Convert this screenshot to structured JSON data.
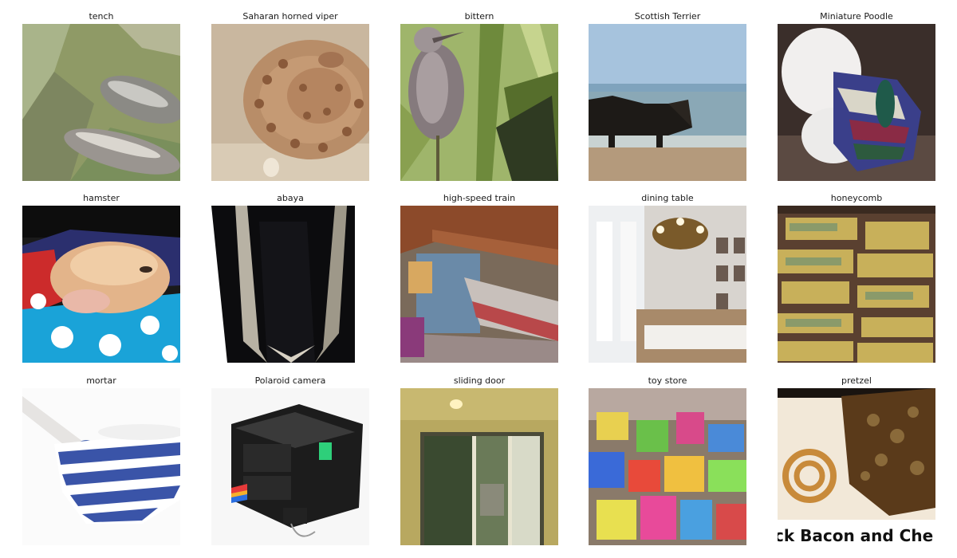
{
  "figure": {
    "panels": [
      {
        "label": "tench",
        "image": "fish-on-green-net"
      },
      {
        "label": "Saharan horned viper",
        "image": "coiled-snake"
      },
      {
        "label": "bittern",
        "image": "heron-among-reeds"
      },
      {
        "label": "Scottish Terrier",
        "image": "dog-at-seashore"
      },
      {
        "label": "Miniature Poodle",
        "image": "white-poodle-in-sweater"
      },
      {
        "label": "hamster",
        "image": "sleeping-hamster"
      },
      {
        "label": "abaya",
        "image": "black-robe"
      },
      {
        "label": "high-speed train",
        "image": "train-in-station"
      },
      {
        "label": "dining table",
        "image": "dining-room-with-chandelier"
      },
      {
        "label": "honeycomb",
        "image": "honeycomb-frames"
      },
      {
        "label": "mortar",
        "image": "striped-mortar-and-pestle"
      },
      {
        "label": "Polaroid camera",
        "image": "instant-camera"
      },
      {
        "label": "sliding door",
        "image": "glass-sliding-door"
      },
      {
        "label": "toy store",
        "image": "toy-shelves"
      },
      {
        "label": "pretzel",
        "image": "pretzel-on-plate"
      }
    ],
    "bottom_caption": "ck Bacon and Che"
  }
}
